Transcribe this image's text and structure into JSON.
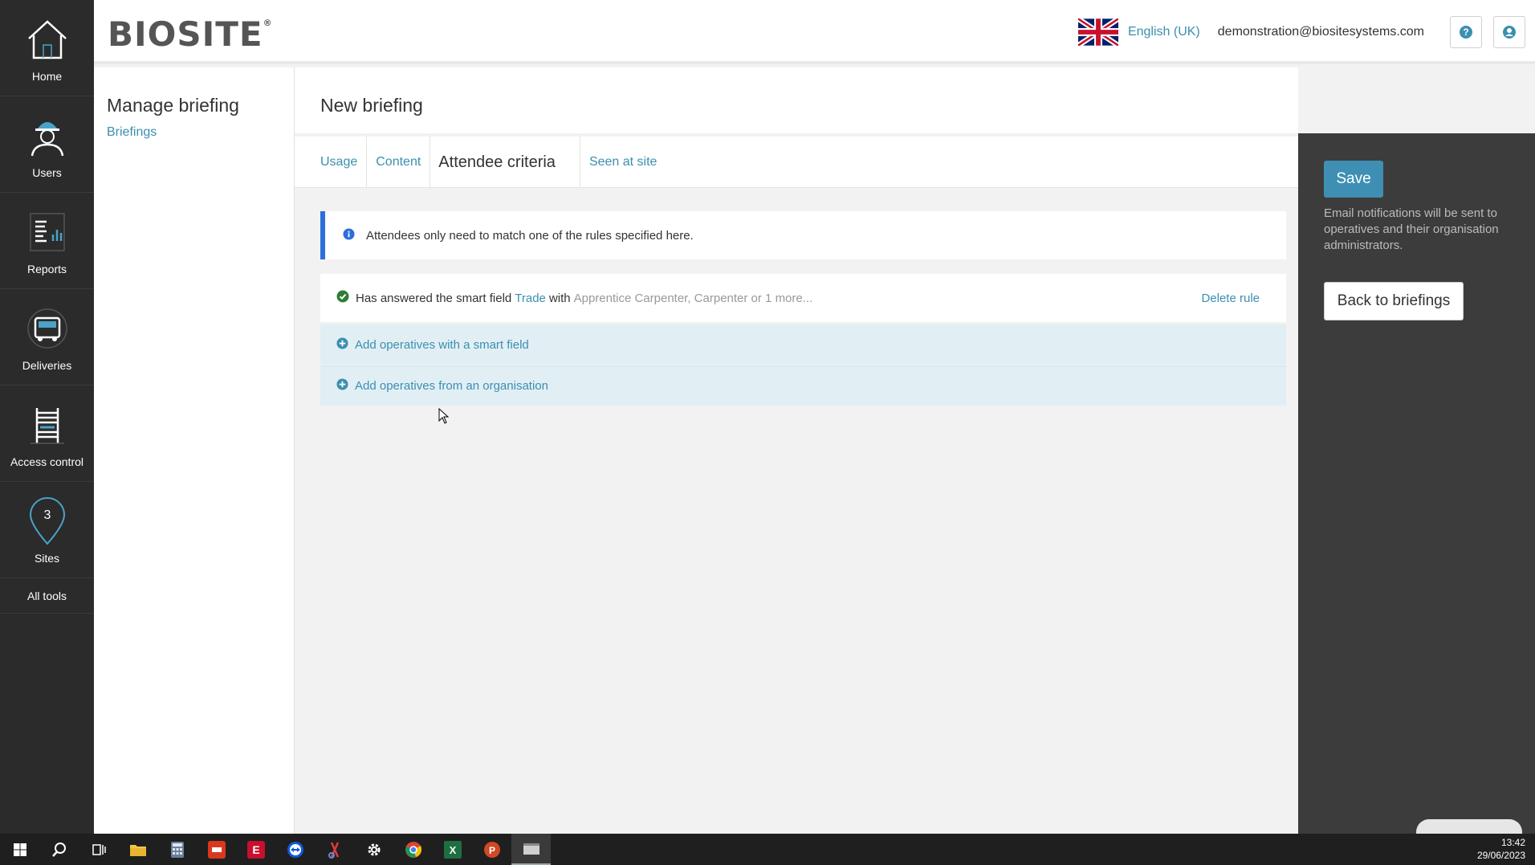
{
  "nav": {
    "items": [
      {
        "label": "Home",
        "icon": "house-icon"
      },
      {
        "label": "Users",
        "icon": "worker-icon"
      },
      {
        "label": "Reports",
        "icon": "reports-icon"
      },
      {
        "label": "Deliveries",
        "icon": "truck-icon"
      },
      {
        "label": "Access control",
        "icon": "turnstile-icon"
      },
      {
        "label": "Sites",
        "icon": "map-pin-icon",
        "badge": "3"
      }
    ],
    "all_tools": "All tools"
  },
  "header": {
    "logo": "BIOSITE",
    "language": "English (UK)",
    "email": "demonstration@biositesystems.com"
  },
  "sidebar": {
    "title": "Manage briefing",
    "link": "Briefings"
  },
  "main": {
    "title": "New briefing",
    "tabs": [
      {
        "label": "Usage"
      },
      {
        "label": "Content"
      },
      {
        "label": "Attendee criteria"
      },
      {
        "label": "Seen at site"
      }
    ],
    "info": "Attendees only need to match one of the rules specified here.",
    "rule": {
      "prefix": "Has answered the smart field",
      "field": "Trade",
      "with": "with",
      "values": "Apprentice Carpenter, Carpenter or 1 more...",
      "delete": "Delete rule"
    },
    "add_smart_field": "Add operatives with a smart field",
    "add_organisation": "Add operatives from an organisation"
  },
  "panel": {
    "save": "Save",
    "note": "Email notifications will be sent to operatives and their organisation administrators.",
    "back": "Back to briefings"
  },
  "taskbar": {
    "time": "13:42",
    "date": "29/06/2023"
  },
  "colors": {
    "accent": "#3b8fb0",
    "info_border": "#2c6fdb",
    "success": "#2e7d32",
    "nav_bg": "#2b2b2b",
    "panel_bg": "#3c3c3c"
  }
}
